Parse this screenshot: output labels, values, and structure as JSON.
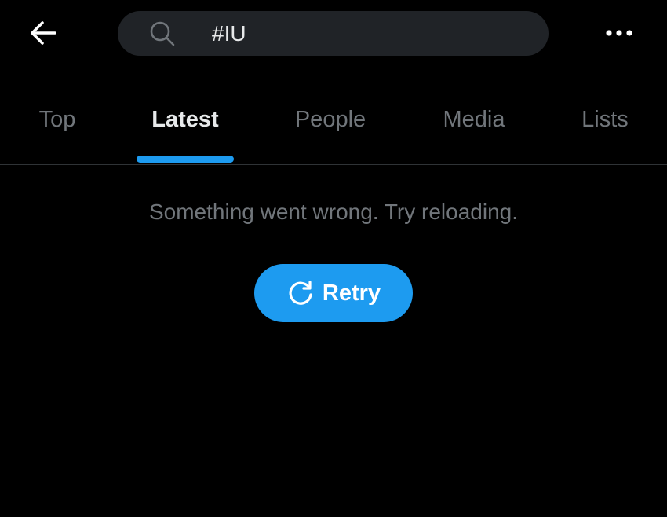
{
  "header": {
    "back_icon": "arrow-left-icon",
    "search": {
      "value": "#IU",
      "icon": "search-icon"
    },
    "more_icon": "ellipsis-icon"
  },
  "tabs": [
    {
      "label": "Top",
      "active": false
    },
    {
      "label": "Latest",
      "active": true
    },
    {
      "label": "People",
      "active": false
    },
    {
      "label": "Media",
      "active": false
    },
    {
      "label": "Lists",
      "active": false
    }
  ],
  "error": {
    "message": "Something went wrong. Try reloading.",
    "retry_label": "Retry",
    "retry_icon": "refresh-icon"
  },
  "colors": {
    "accent": "#1d9bf0",
    "background": "#000000",
    "search_bg": "#202327",
    "muted_text": "#71767b"
  }
}
